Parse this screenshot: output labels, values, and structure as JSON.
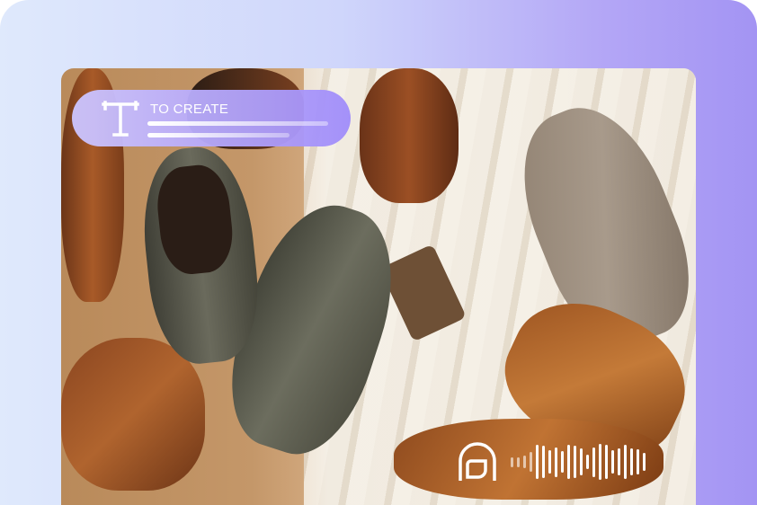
{
  "badge": {
    "label": "TO CREATE",
    "icon": "text-t-icon"
  },
  "audio": {
    "logo_icon": "brand-logo-icon",
    "waveform_levels": [
      0.25,
      0.25,
      0.3,
      0.5,
      0.85,
      0.8,
      0.6,
      0.75,
      0.55,
      0.85,
      0.8,
      0.7,
      0.35,
      0.75,
      0.9,
      0.85,
      0.6,
      0.7,
      0.85,
      0.7,
      0.65,
      0.45
    ]
  },
  "colors": {
    "accent": "#a394f3",
    "background_light": "#dfe9fc"
  }
}
